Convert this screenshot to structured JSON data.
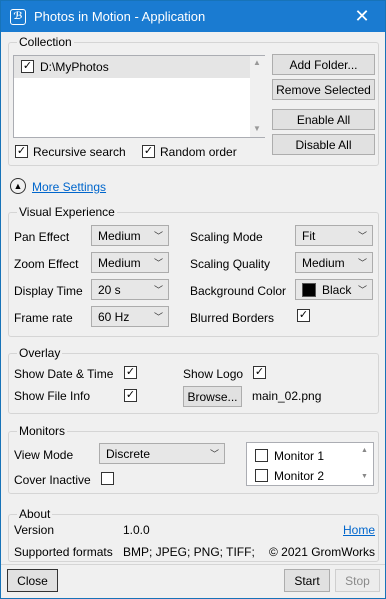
{
  "window": {
    "title": "Photos in Motion - Application"
  },
  "collection": {
    "title": "Collection",
    "folders": [
      {
        "path": "D:\\MyPhotos",
        "checked": true
      }
    ],
    "buttons": {
      "add_folder": "Add Folder...",
      "remove_selected": "Remove Selected",
      "enable_all": "Enable All",
      "disable_all": "Disable All"
    },
    "recursive_label": "Recursive search",
    "recursive_checked": true,
    "random_label": "Random order",
    "random_checked": true
  },
  "more_settings": {
    "label": "More Settings"
  },
  "visual": {
    "title": "Visual Experience",
    "pan_label": "Pan Effect",
    "pan_value": "Medium",
    "zoom_label": "Zoom Effect",
    "zoom_value": "Medium",
    "display_label": "Display Time",
    "display_value": "20 s",
    "frame_label": "Frame rate",
    "frame_value": "60 Hz",
    "scaling_mode_label": "Scaling Mode",
    "scaling_mode_value": "Fit",
    "scaling_quality_label": "Scaling Quality",
    "scaling_quality_value": "Medium",
    "bg_label": "Background Color",
    "bg_value": "Black",
    "bg_color": "#000000",
    "blurred_label": "Blurred Borders",
    "blurred_checked": true
  },
  "overlay": {
    "title": "Overlay",
    "date_label": "Show Date & Time",
    "date_checked": true,
    "file_label": "Show File Info",
    "file_checked": true,
    "logo_label": "Show Logo",
    "logo_checked": true,
    "browse_label": "Browse...",
    "logo_file": "main_02.png"
  },
  "monitors": {
    "title": "Monitors",
    "view_label": "View Mode",
    "view_value": "Discrete",
    "cover_label": "Cover Inactive",
    "cover_checked": false,
    "list": [
      {
        "name": "Monitor 1",
        "checked": false
      },
      {
        "name": "Monitor 2",
        "checked": false
      }
    ]
  },
  "about": {
    "title": "About",
    "version_label": "Version",
    "version_value": "1.0.0",
    "home_link": "Home",
    "formats_label": "Supported formats",
    "formats_value": "BMP; JPEG; PNG; TIFF;",
    "copyright": "© 2021 GromWorks"
  },
  "footer": {
    "close": "Close",
    "start": "Start",
    "stop": "Stop"
  },
  "colors": {
    "titlebar": "#1a7bd1",
    "link": "#0066cc"
  }
}
